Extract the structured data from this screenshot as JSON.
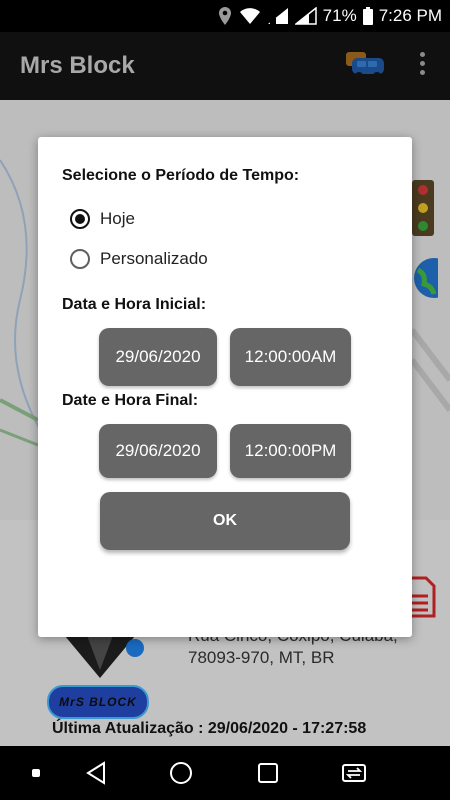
{
  "status_bar": {
    "battery_percent": "71%",
    "time": "7:26 PM"
  },
  "app_bar": {
    "title": "Mrs Block"
  },
  "background": {
    "address_line1": "Rua Cinco, Coxipó, Cuiabá,",
    "address_line2": "78093-970, MT, BR",
    "last_update": "Última Atualização : 29/06/2020 - 17:27:58",
    "logo_text": "MrS BLOCK"
  },
  "dialog": {
    "heading": "Selecione o Período de Tempo:",
    "options": [
      {
        "label": "Hoje",
        "selected": true
      },
      {
        "label": "Personalizado",
        "selected": false
      }
    ],
    "start_label": "Data e Hora Inicial:",
    "start_date": "29/06/2020",
    "start_time": "12:00:00AM",
    "end_label": "Date e Hora Final:",
    "end_date": "29/06/2020",
    "end_time": "12:00:00PM",
    "ok_label": "OK"
  },
  "colors": {
    "button": "#666666",
    "dialog_bg": "#ffffff",
    "app_bar": "#101010"
  }
}
